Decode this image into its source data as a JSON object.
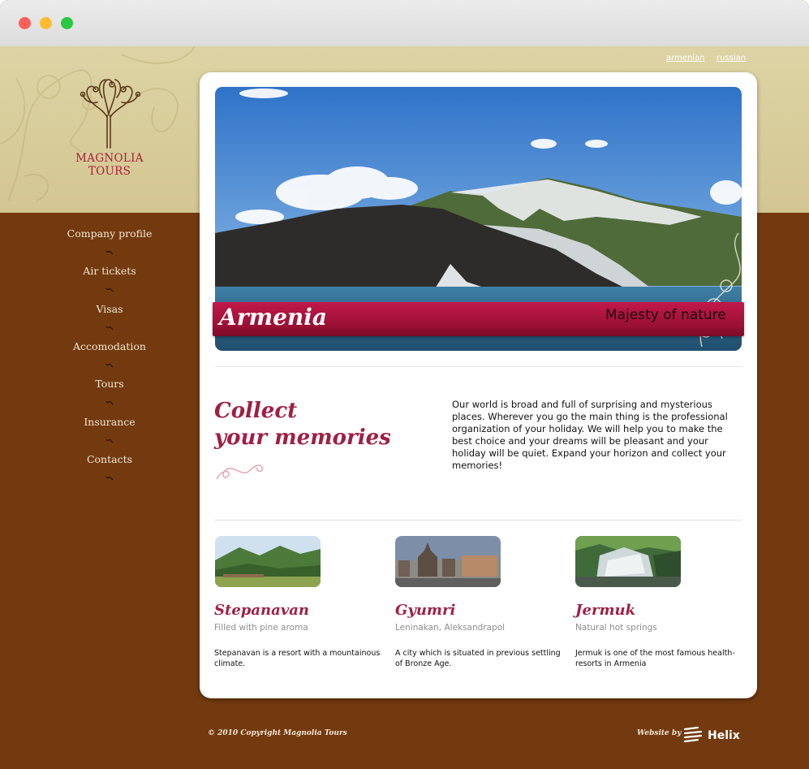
{
  "languages": [
    "armenian",
    "russian"
  ],
  "logo": {
    "line1": "MAGNOLIA",
    "line2": "TOURS"
  },
  "nav": [
    "Company profile",
    "Air tickets",
    "Visas",
    "Accomodation",
    "Tours",
    "Insurance",
    "Contacts"
  ],
  "hero": {
    "title": "Armenia",
    "subtitle": "Majesty of nature"
  },
  "intro": {
    "heading_line1": "Collect",
    "heading_line2": "your memories",
    "text": "Our world is broad and full of surprising and mysterious places. Wherever you go the main thing is the professional organization of your holiday. We will help you to make the best choice and your dreams will be pleasant and your holiday will be quiet. Expand your horizon and collect your memories!"
  },
  "destinations": [
    {
      "title": "Stepanavan",
      "subtitle": "Filled with pine aroma",
      "text": "Stepanavan is a resort with a mountainous climate."
    },
    {
      "title": "Gyumri",
      "subtitle": "Leninakan, Aleksandrapol",
      "text": "A city which is situated in previous settling of Bronze Age."
    },
    {
      "title": "Jermuk",
      "subtitle": "Natural hot springs",
      "text": "Jermuk is one of the most famous health-resorts in Armenia"
    }
  ],
  "footer": {
    "copyright": "© 2010 Copyright Magnolia Tours",
    "website_by": "Website by",
    "agency": "Helix"
  },
  "colors": {
    "accent": "#a01f43",
    "brown": "#733a10",
    "sand": "#d8cc9a"
  }
}
